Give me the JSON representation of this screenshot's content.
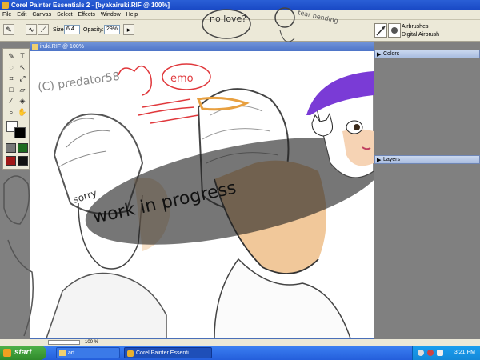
{
  "window": {
    "title": "Corel Painter Essentials 2 - [byakairuki.RIF @ 100%]"
  },
  "menu": {
    "items": [
      "File",
      "Edit",
      "Canvas",
      "Select",
      "Effects",
      "Window",
      "Help"
    ]
  },
  "property_bar": {
    "size_label": "Size:",
    "size_value": "6.4",
    "opacity_label": "Opacity:",
    "opacity_value": "29%"
  },
  "brush_selector": {
    "category": "Airbrushes",
    "variant": "Digital Airbrush"
  },
  "document": {
    "tab_title": "iruki.RIF @ 100%"
  },
  "palettes": {
    "colors_title": "Colors",
    "layers_title": "Layers"
  },
  "overlay_doodles": {
    "no_love": "no love?",
    "tear_bending": "tear bending",
    "emo": "emo",
    "copyright": "(C) predator58",
    "sorry": "sorry",
    "work_in_progress": "work in progress"
  },
  "statusbar": {
    "zoom": "100 %"
  },
  "taskbar": {
    "start_label": "start",
    "items": [
      {
        "label": "art"
      },
      {
        "label": "Corel Painter Essenti..."
      }
    ],
    "clock": "3:21 PM"
  },
  "colors": {
    "title_blue": "#1848c4",
    "taskbar_blue": "#245edb",
    "start_green": "#2f8a2b",
    "beanie_purple": "#7a3bd6",
    "skin": "#f1c89a",
    "sketch_red": "#e0383c",
    "sketch_orange": "#e8a040"
  }
}
